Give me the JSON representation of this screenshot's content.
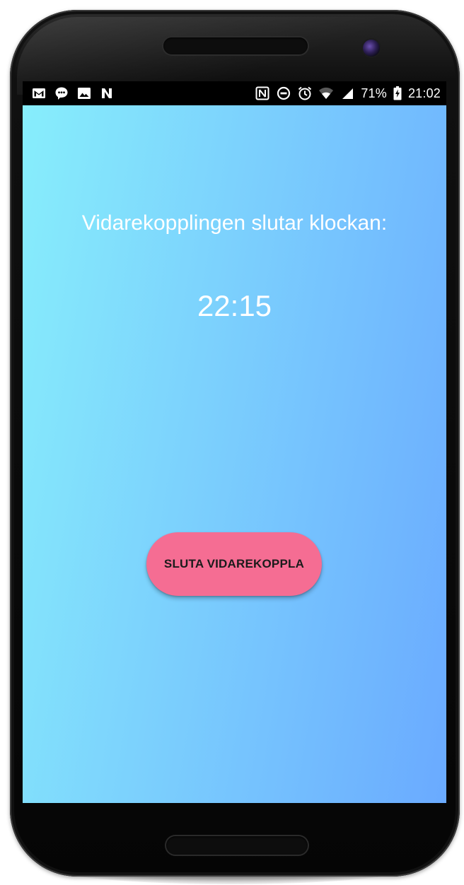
{
  "status_bar": {
    "left_icons": [
      "gmail-icon",
      "chat-bubble-icon",
      "image-icon",
      "n-app-icon"
    ],
    "right_icons": [
      "nfc-icon",
      "do-not-disturb-icon",
      "alarm-icon",
      "wifi-icon",
      "signal-icon"
    ],
    "battery_percent": "71%",
    "battery_icon": "battery-charging-icon",
    "time": "21:02"
  },
  "app": {
    "message": "Vidarekopplingen slutar klockan:",
    "end_time": "22:15",
    "stop_button_label": "SLUTA VIDAREKOPPLA"
  },
  "colors": {
    "background_start": "#87eefc",
    "background_end": "#6aaaff",
    "button": "#f56d93",
    "text": "#ffffff"
  }
}
